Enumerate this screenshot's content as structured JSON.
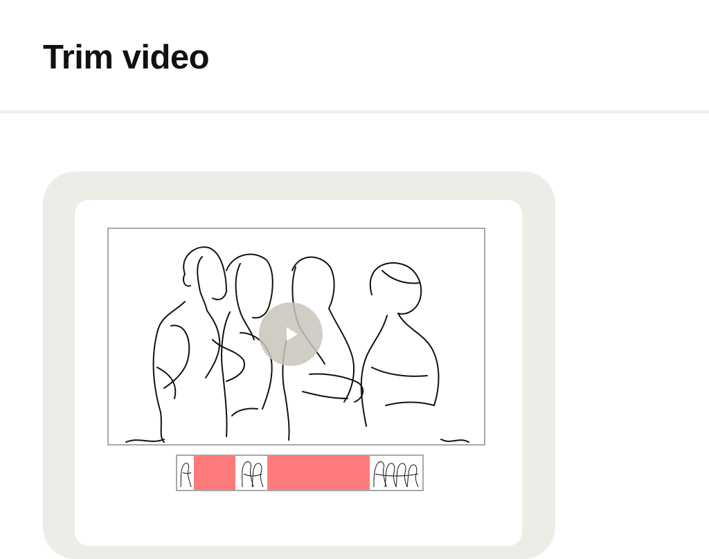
{
  "header": {
    "title": "Trim video"
  },
  "player": {
    "play_icon": "play-icon",
    "illustration": "line-drawing-of-four-people-looking-up"
  },
  "timeline": {
    "trim_color": "#ff7b7b",
    "segments": [
      "thumbnail",
      "removed",
      "thumbnail",
      "removed",
      "thumbnail"
    ]
  },
  "colors": {
    "frame": "#eeece7",
    "play_button": "#c8c5ba",
    "border": "#a8a8a8"
  }
}
